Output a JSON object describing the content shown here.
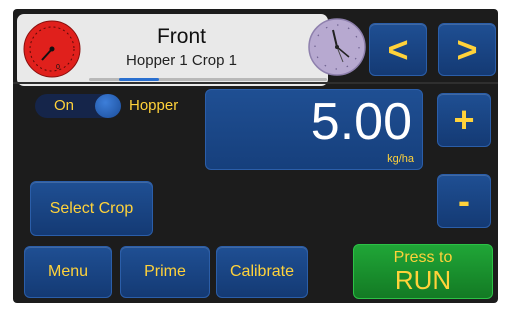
{
  "header": {
    "title": "Front",
    "subtitle": "Hopper 1 Crop 1",
    "prev_label": "<",
    "next_label": ">"
  },
  "hopper": {
    "toggle_label": "On",
    "toggle_state": true,
    "label": "Hopper"
  },
  "rate": {
    "value": "5.00",
    "unit": "kg/ha",
    "plus_label": "+",
    "minus_label": "-"
  },
  "select_crop_label": "Select Crop",
  "bottom": {
    "menu_label": "Menu",
    "prime_label": "Prime",
    "calibrate_label": "Calibrate"
  },
  "run": {
    "line1": "Press to",
    "line2": "RUN"
  },
  "colors": {
    "button_blue": "#1f4f93",
    "label_yellow": "#ffd23a",
    "run_green": "#20a637",
    "gauge_red": "#e0201c",
    "clock_lavender": "#b7a9d0"
  },
  "icons": {
    "gauge": "speedometer-gauge-icon",
    "clock": "analog-clock-icon"
  }
}
